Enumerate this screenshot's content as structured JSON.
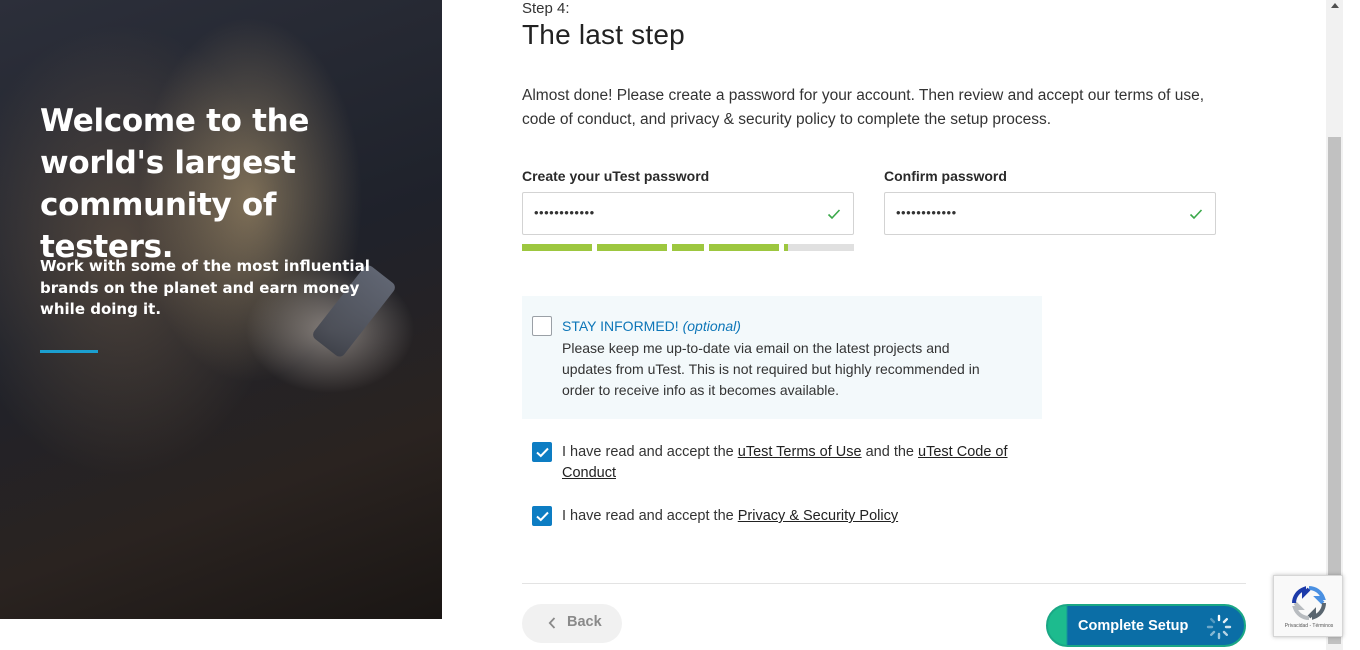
{
  "hero": {
    "title": "Welcome to the\nworld's largest\ncommunity of testers.",
    "subtitle": "Work with some of the most influential brands on the planet and earn money while doing it.",
    "accent_color": "#1b9fd0"
  },
  "header": {
    "step_label": "Step 4:",
    "title": "The last step",
    "intro": "Almost done! Please create a password for your account. Then review and accept our terms of use, code of conduct, and privacy & security policy to complete the setup process."
  },
  "password": {
    "label": "Create your uTest password",
    "value": "••••••••••••",
    "valid_icon": "checkmark-icon",
    "strength_fraction": 0.85,
    "strength_color": "#9dc73f"
  },
  "confirm_password": {
    "label": "Confirm password",
    "value": "••••••••••••",
    "valid_icon": "checkmark-icon"
  },
  "stay_informed": {
    "heading": "STAY INFORMED!",
    "optional": "(optional)",
    "text": "Please keep me up-to-date via email on the latest projects and updates from uTest. This is not required but highly recommended in order to receive info as it becomes available.",
    "checked": false
  },
  "terms": {
    "prefix": "I have read and accept the ",
    "terms_link": "uTest Terms of Use",
    "middle": " and the ",
    "code_link": "uTest Code of Conduct",
    "checked": true
  },
  "privacy": {
    "prefix": "I have read and accept the ",
    "privacy_link": "Privacy & Security Policy",
    "checked": true
  },
  "actions": {
    "back_label": "Back",
    "complete_label": "Complete Setup",
    "complete_state": "loading",
    "brand_color": "#0b6ea6",
    "accent_color": "#1dbb8e"
  },
  "recaptcha": {
    "links": "Privacidad - Términos"
  }
}
